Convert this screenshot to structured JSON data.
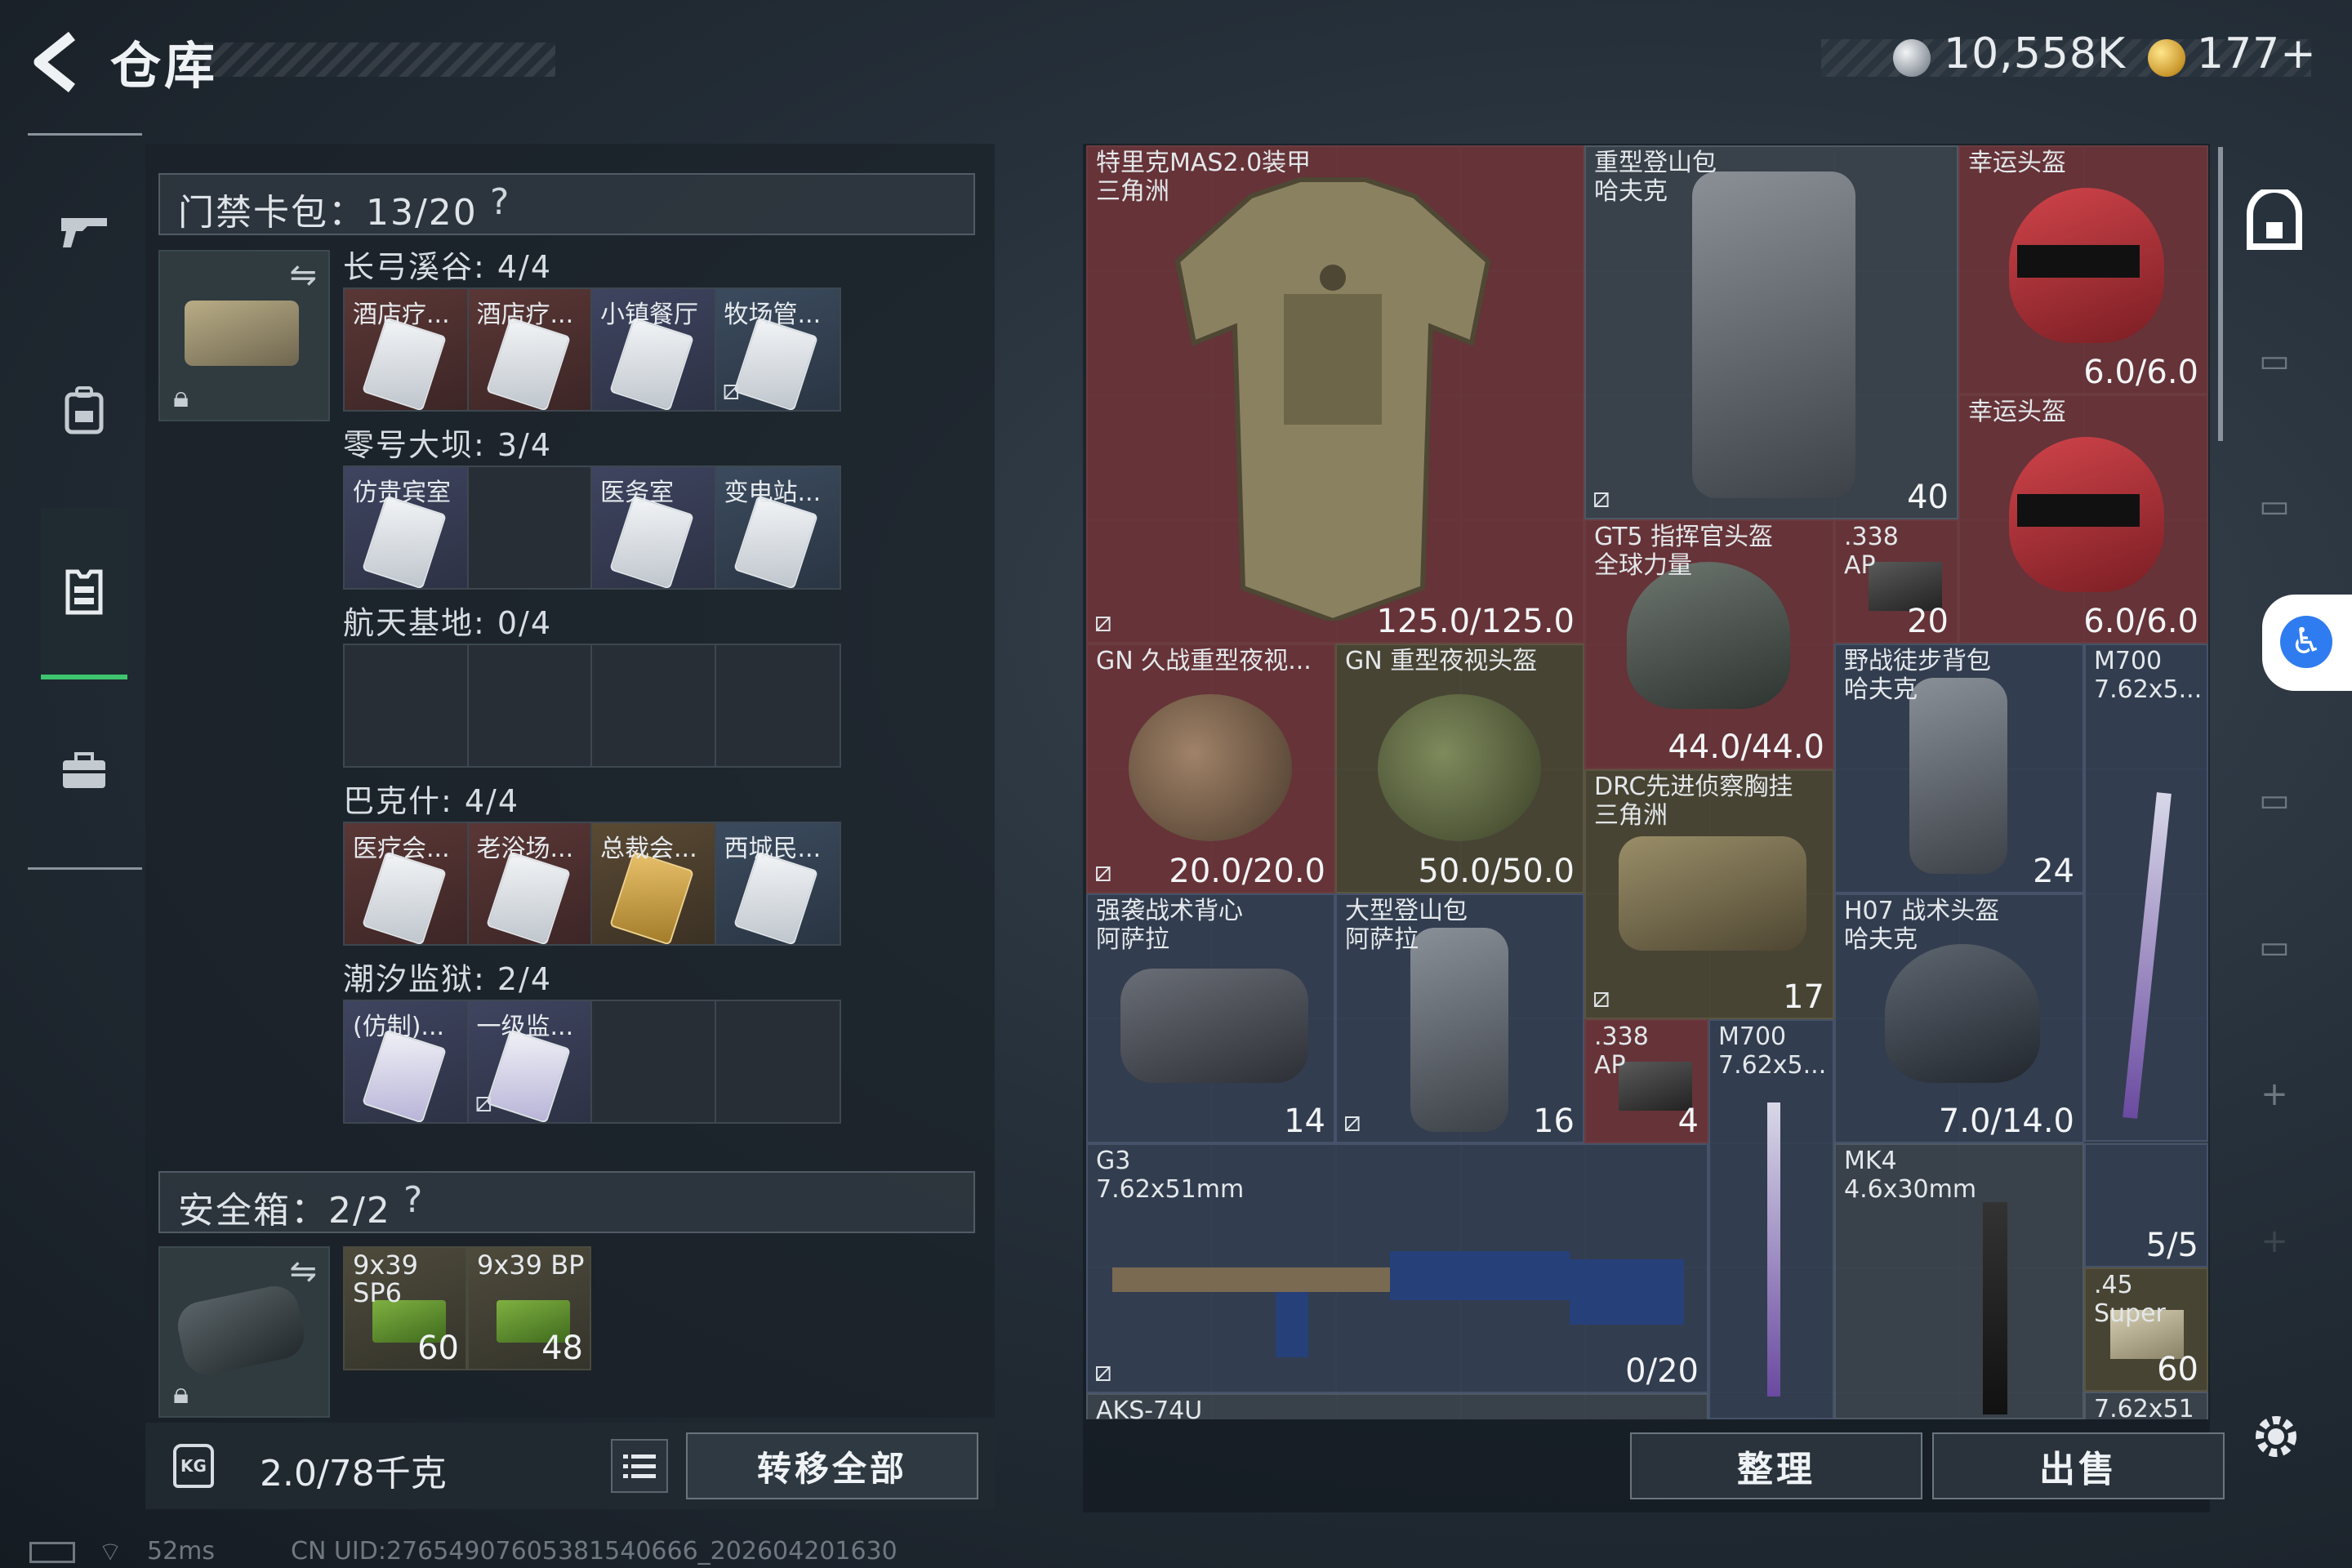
{
  "header": {
    "title": "仓库",
    "silver": "10,558K",
    "gold": "177+"
  },
  "nav": [
    "weapon-icon",
    "backpack-icon",
    "vest-icon",
    "briefcase-icon"
  ],
  "keycard_pouch": {
    "title": "门禁卡包：13/20",
    "help": "?",
    "groups": [
      {
        "label": "长弓溪谷: 4/4",
        "cards": [
          "酒店疗...",
          "酒店疗...",
          "小镇餐厅",
          "牧场管..."
        ]
      },
      {
        "label": "零号大坝: 3/4",
        "cards": [
          "仿贵宾室",
          "",
          "医务室",
          "变电站..."
        ]
      },
      {
        "label": "航天基地: 0/4",
        "cards": [
          "",
          "",
          "",
          ""
        ]
      },
      {
        "label": "巴克什: 4/4",
        "cards": [
          "医疗会...",
          "老浴场...",
          "总裁会...",
          "西城民..."
        ]
      },
      {
        "label": "潮汐监狱: 2/4",
        "cards": [
          "(仿制)...",
          "一级监...",
          "",
          ""
        ]
      }
    ]
  },
  "safe_box": {
    "title": "安全箱：2/2",
    "help": "?",
    "ammo": [
      {
        "name": "9x39 SP6",
        "count": "60"
      },
      {
        "name": "9x39 BP",
        "count": "48"
      }
    ]
  },
  "footer_left": {
    "weight_badge": "KG",
    "weight": "2.0/78千克",
    "transfer_all": "转移全部"
  },
  "status": {
    "ping": "52ms",
    "uid": "CN UID:2765490760538154066​6_202604201630"
  },
  "inventory": [
    {
      "name": "特里克MAS2.0装甲\n三角洲",
      "value": "125.0/125.0",
      "rarity": "red"
    },
    {
      "name": "重型登山包\n哈夫克",
      "value": "40",
      "rarity": "gray"
    },
    {
      "name": "幸运头盔",
      "value": "6.0/6.0",
      "rarity": "red"
    },
    {
      "name": "幸运头盔",
      "value": "6.0/6.0",
      "rarity": "red"
    },
    {
      "name": "GT5 指挥官头盔\n全球力量",
      "value": "44.0/44.0",
      "rarity": "red"
    },
    {
      "name": ".338\nAP",
      "value": "20",
      "rarity": "red"
    },
    {
      "name": "GN 久战重型夜视...",
      "value": "20.0/20.0",
      "rarity": "red"
    },
    {
      "name": "GN 重型夜视头盔",
      "value": "50.0/50.0",
      "rarity": "olive"
    },
    {
      "name": "DRC先进侦察胸挂\n三角洲",
      "value": "17",
      "rarity": "olive"
    },
    {
      "name": "野战徒步背包\n哈夫克",
      "value": "24",
      "rarity": "blue"
    },
    {
      "name": "M700\n7.62x5...",
      "value": "",
      "rarity": "blue"
    },
    {
      "name": "强袭战术背心\n阿萨拉",
      "value": "14",
      "rarity": "blue"
    },
    {
      "name": "大型登山包\n阿萨拉",
      "value": "16",
      "rarity": "blue"
    },
    {
      "name": ".338\nAP",
      "value": "4",
      "rarity": "red"
    },
    {
      "name": "M700\n7.62x5...",
      "value": "",
      "rarity": "blue"
    },
    {
      "name": "H07 战术头盔\n哈夫克",
      "value": "7.0/14.0",
      "rarity": "blue"
    },
    {
      "name": "G3\n7.62x51mm",
      "value": "0/20",
      "rarity": "blue"
    },
    {
      "name": "MK4\n4.6x30mm",
      "value": "",
      "rarity": "gray"
    },
    {
      "name": "",
      "value": "5/5",
      "rarity": "blue"
    },
    {
      "name": ".45\nSuper",
      "value": "60",
      "rarity": "olive"
    },
    {
      "name": "AKS-74U",
      "value": "",
      "rarity": "gray"
    },
    {
      "name": "7.62x51",
      "value": "",
      "rarity": "gray"
    }
  ],
  "actions": {
    "sort": "整理",
    "sell": "出售"
  },
  "right_sidebar": [
    "safe-box-icon",
    "V-rifle-icon",
    "III-rifle-icon",
    "IV-rifle-icon",
    "IV-rifle-icon",
    "IV-rifle-icon",
    "+",
    "+"
  ],
  "colors": {
    "accent_green": "#3ec56e",
    "rarity_red": "#703438",
    "rarity_blue": "#344054",
    "rarity_gold": "#c9962b"
  }
}
